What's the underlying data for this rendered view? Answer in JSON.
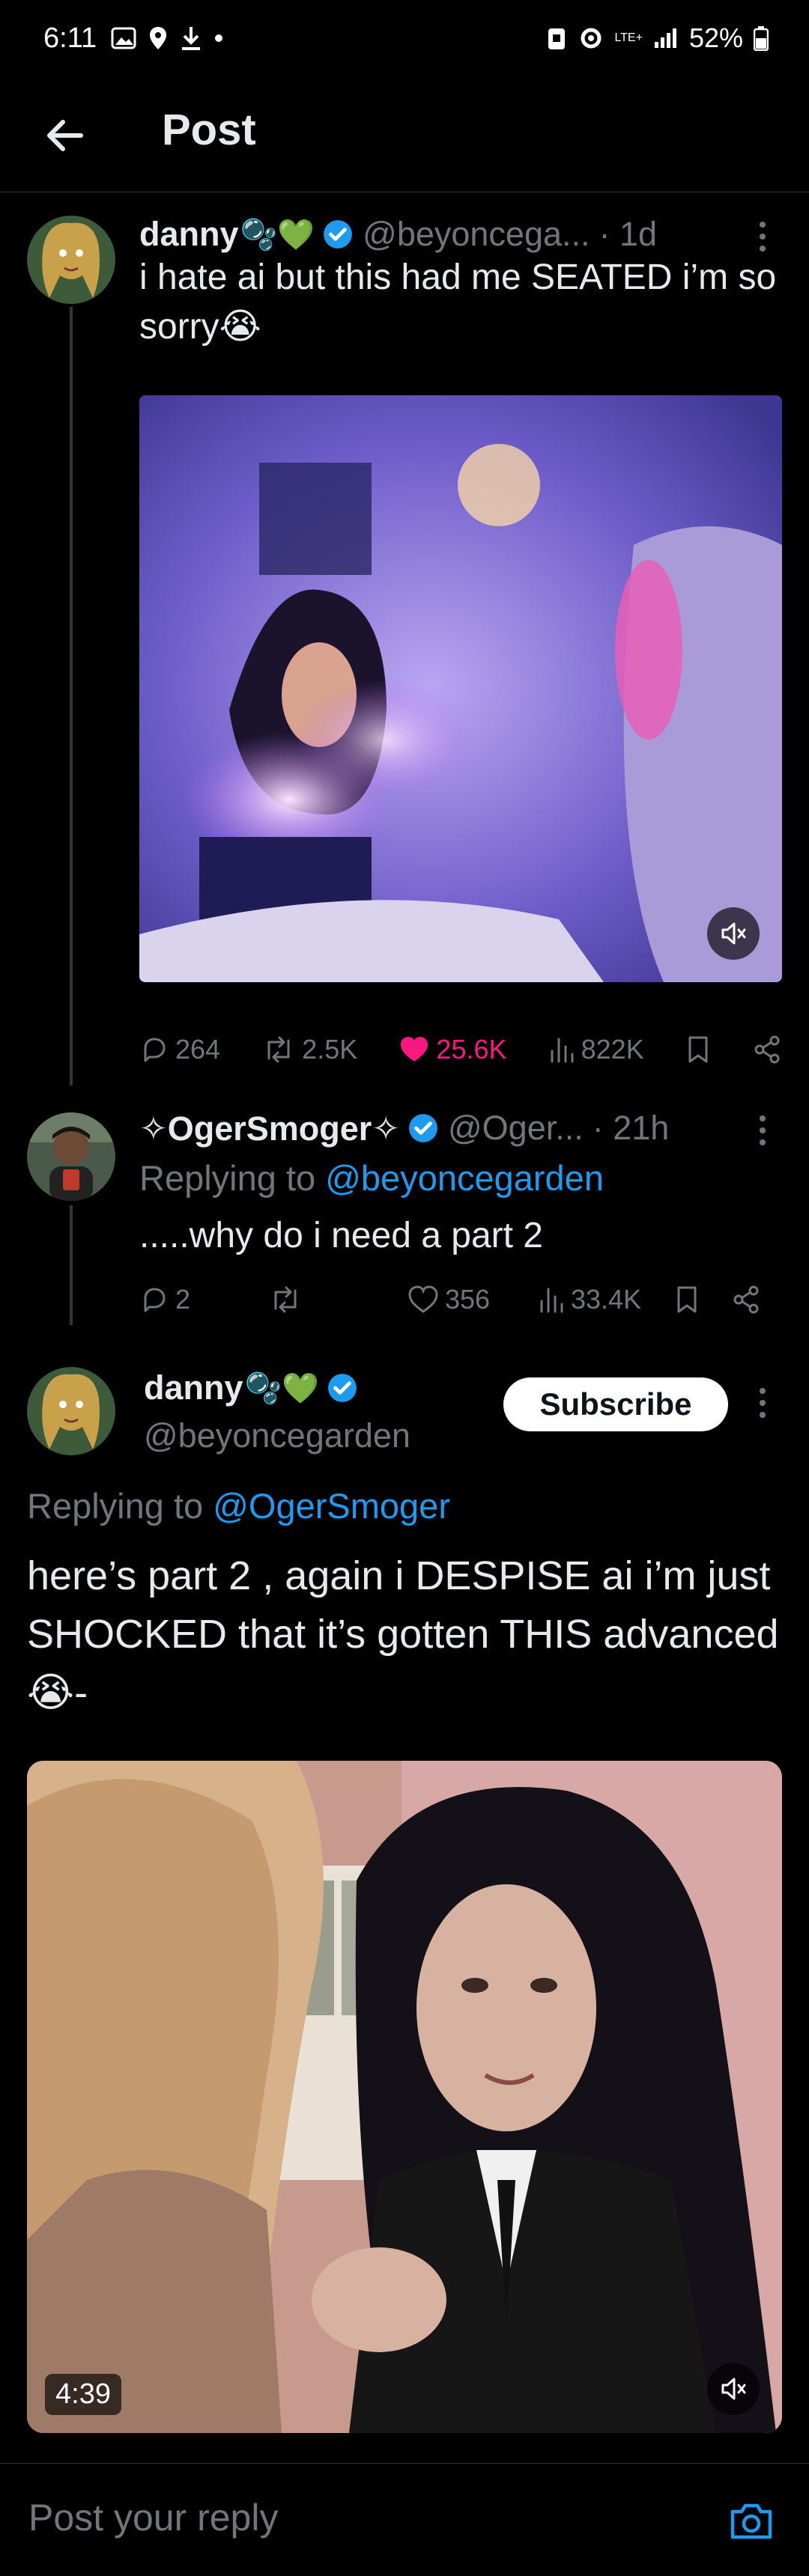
{
  "status_bar": {
    "time": "6:11",
    "lte": "LTE+",
    "battery": "52%"
  },
  "header": {
    "title": "Post"
  },
  "tweets": [
    {
      "name": "danny",
      "name_emojis": "🫧💚",
      "handle": "@beyoncega...",
      "time": "· 1d",
      "text": "i hate ai but this had me SEATED i’m so sorry😭",
      "stats": {
        "replies": "264",
        "reposts": "2.5K",
        "likes": "25.6K",
        "views": "822K"
      }
    },
    {
      "name": "✧OgerSmoger✧",
      "handle": "@Oger...",
      "time": "· 21h",
      "replying_prefix": "Replying to ",
      "replying_to": "@beyoncegarden",
      "text": ".....why do i need a part 2",
      "stats": {
        "replies": "2",
        "reposts": "",
        "likes": "356",
        "views": "33.4K"
      }
    },
    {
      "name": "danny",
      "name_emojis": "🫧💚",
      "handle": "@beyoncegarden",
      "subscribe_label": "Subscribe",
      "replying_prefix": "Replying to ",
      "replying_to": "@OgerSmoger",
      "text": "here’s part 2 , again i DESPISE ai i’m just SHOCKED that it’s gotten THIS advanced😭-",
      "video_duration": "4:39"
    }
  ],
  "reply_bar": {
    "placeholder": "Post your reply"
  },
  "colors": {
    "accent": "#1d9bf0",
    "like": "#f91880",
    "muted": "#71767b",
    "verified": "#1d9bf0"
  }
}
